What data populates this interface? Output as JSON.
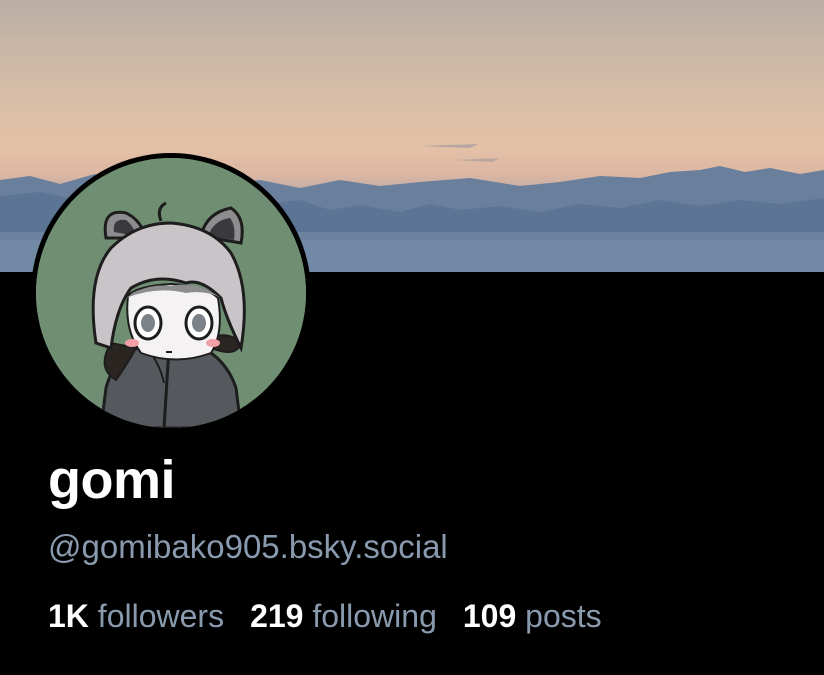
{
  "profile": {
    "display_name": "gomi",
    "handle": "@gomibako905.bsky.social"
  },
  "stats": {
    "followers": {
      "count": "1K",
      "label": "followers"
    },
    "following": {
      "count": "219",
      "label": "following"
    },
    "posts": {
      "count": "109",
      "label": "posts"
    }
  },
  "colors": {
    "background": "#000000",
    "name": "#ffffff",
    "secondary_text": "#8a9aae",
    "avatar_bg": "#6f8e72"
  }
}
